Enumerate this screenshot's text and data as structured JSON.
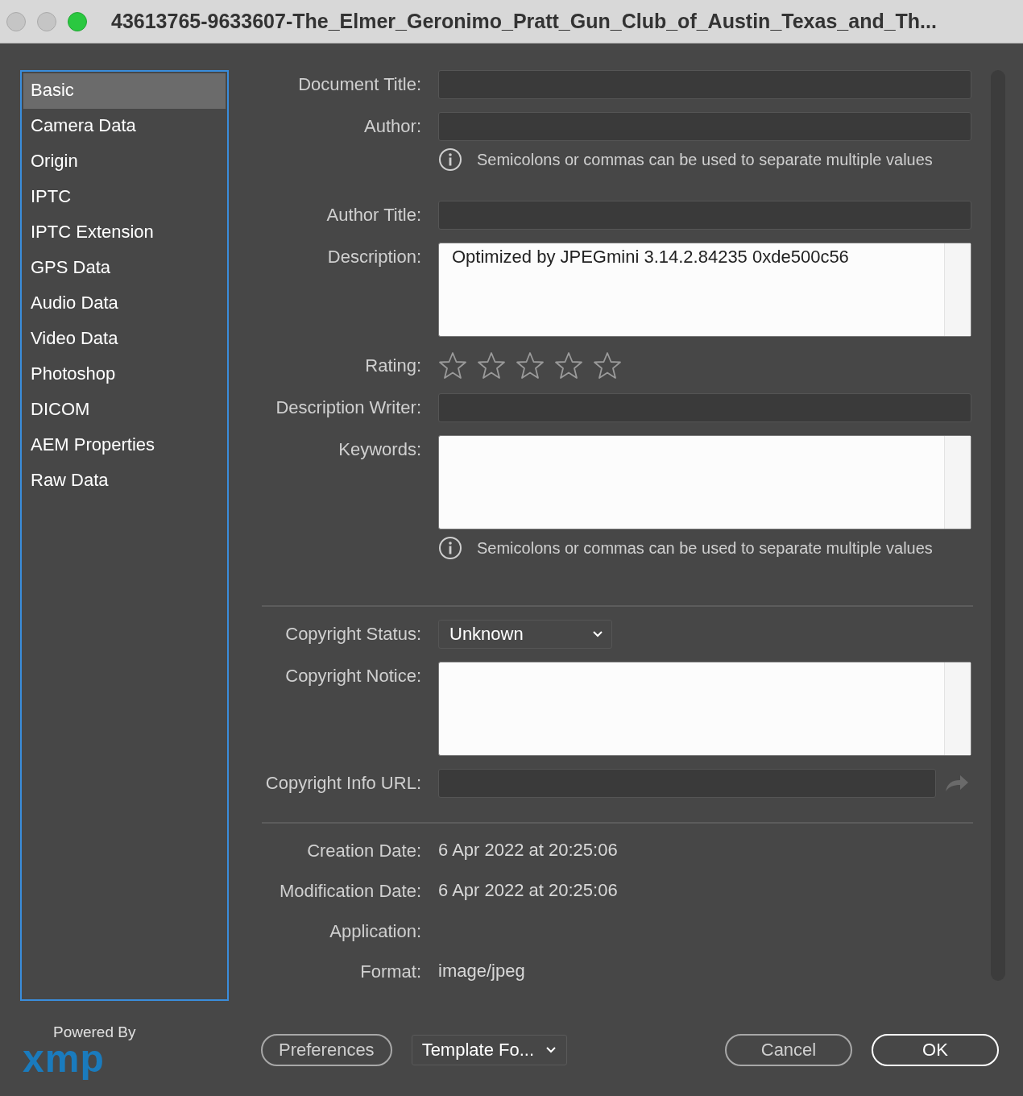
{
  "window": {
    "title": "43613765-9633607-The_Elmer_Geronimo_Pratt_Gun_Club_of_Austin_Texas_and_Th..."
  },
  "sidebar": {
    "items": [
      {
        "label": "Basic",
        "selected": true
      },
      {
        "label": "Camera Data",
        "selected": false
      },
      {
        "label": "Origin",
        "selected": false
      },
      {
        "label": "IPTC",
        "selected": false
      },
      {
        "label": "IPTC Extension",
        "selected": false
      },
      {
        "label": "GPS Data",
        "selected": false
      },
      {
        "label": "Audio Data",
        "selected": false
      },
      {
        "label": "Video Data",
        "selected": false
      },
      {
        "label": "Photoshop",
        "selected": false
      },
      {
        "label": "DICOM",
        "selected": false
      },
      {
        "label": "AEM Properties",
        "selected": false
      },
      {
        "label": "Raw Data",
        "selected": false
      }
    ]
  },
  "form": {
    "rows": [
      {
        "kind": "text",
        "label": "Document Title:"
      },
      {
        "kind": "text",
        "label": "Author:"
      },
      {
        "kind": "note",
        "text": "Semicolons or commas can be used to separate multiple values"
      },
      {
        "kind": "text",
        "label": "Author Title:"
      },
      {
        "kind": "textarea",
        "label": "Description:",
        "value": "Optimized by JPEGmini 3.14.2.84235 0xde500c56"
      },
      {
        "kind": "rating",
        "label": "Rating:",
        "stars": 0
      },
      {
        "kind": "text",
        "label": "Description Writer:"
      },
      {
        "kind": "textarea",
        "label": "Keywords:"
      },
      {
        "kind": "note",
        "text": "Semicolons or commas can be used to separate multiple values"
      },
      {
        "kind": "divider"
      },
      {
        "kind": "dropdown",
        "label": "Copyright Status:",
        "value": "Unknown"
      },
      {
        "kind": "textarea",
        "label": "Copyright Notice:"
      },
      {
        "kind": "url",
        "label": "Copyright Info URL:"
      },
      {
        "kind": "divider"
      },
      {
        "kind": "static",
        "label": "Creation Date:",
        "value": "6 Apr 2022 at 20:25:06"
      },
      {
        "kind": "static",
        "label": "Modification Date:",
        "value": "6 Apr 2022 at 20:25:06"
      },
      {
        "kind": "static",
        "label": "Application:"
      },
      {
        "kind": "static",
        "label": "Format:",
        "value": "image/jpeg"
      }
    ]
  },
  "footer": {
    "powered_by": "Powered By",
    "logo": "xmp",
    "buttons": [
      {
        "kind": "button",
        "label": "Preferences"
      },
      {
        "kind": "dropdown",
        "label": "Template Fo..."
      },
      {
        "kind": "spacer"
      },
      {
        "kind": "button",
        "label": "Cancel"
      },
      {
        "kind": "default",
        "label": "OK"
      }
    ]
  }
}
